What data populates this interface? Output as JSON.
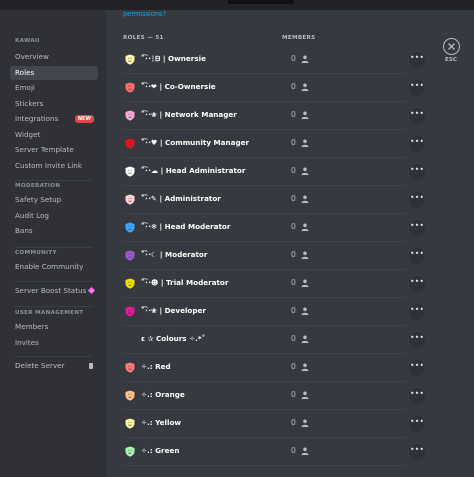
{
  "sidebar": {
    "server_name": "KAWAII",
    "items_top": [
      {
        "label": "Overview",
        "name": "sidebar-item-overview",
        "selected": false
      },
      {
        "label": "Roles",
        "name": "sidebar-item-roles",
        "selected": true
      },
      {
        "label": "Emoji",
        "name": "sidebar-item-emoji",
        "selected": false
      },
      {
        "label": "Stickers",
        "name": "sidebar-item-stickers",
        "selected": false
      },
      {
        "label": "Integrations",
        "name": "sidebar-item-integrations",
        "selected": false,
        "badge": "NEW"
      },
      {
        "label": "Widget",
        "name": "sidebar-item-widget",
        "selected": false
      },
      {
        "label": "Server Template",
        "name": "sidebar-item-server-template",
        "selected": false
      },
      {
        "label": "Custom Invite Link",
        "name": "sidebar-item-custom-invite-link",
        "selected": false
      }
    ],
    "moderation_title": "MODERATION",
    "moderation_items": [
      {
        "label": "Safety Setup",
        "name": "sidebar-item-safety-setup"
      },
      {
        "label": "Audit Log",
        "name": "sidebar-item-audit-log"
      },
      {
        "label": "Bans",
        "name": "sidebar-item-bans"
      }
    ],
    "community_title": "COMMUNITY",
    "community_items": [
      {
        "label": "Enable Community",
        "name": "sidebar-item-enable-community"
      }
    ],
    "boost_label": "Server Boost Status",
    "user_mgmt_title": "USER MANAGEMENT",
    "user_mgmt_items": [
      {
        "label": "Members",
        "name": "sidebar-item-members"
      },
      {
        "label": "Invites",
        "name": "sidebar-item-invites"
      }
    ],
    "delete_label": "Delete Server"
  },
  "main": {
    "permissions_link": "permissions?",
    "roles_header": "ROLES — 51",
    "members_header": "MEMBERS",
    "esc_label": "ESC",
    "roles": [
      {
        "name": "˚͡˔·ᛁᗹ | Ownersie",
        "color": "#fff3b0",
        "members": "0"
      },
      {
        "name": "˚͡˔·❤ | Co-Ownersie",
        "color": "#ff6b6b",
        "members": "0"
      },
      {
        "name": "˚͡˔·❀ | Network Manager",
        "color": "#f7a8d8",
        "members": "0"
      },
      {
        "name": "˚͡˔·♥ | Community Manager",
        "color": "#e81123",
        "members": "0"
      },
      {
        "name": "˚͡˔·☁ | Head Administrator",
        "color": "#ffffff",
        "members": "0"
      },
      {
        "name": "˚͡˔·✎ | Administrator",
        "color": "#ffd1d1",
        "members": "0"
      },
      {
        "name": "˚͡˔·❄ | Head Moderator",
        "color": "#3ba6ff",
        "members": "0"
      },
      {
        "name": "˚͡˔·☾ | Moderator",
        "color": "#9b59d6",
        "members": "0"
      },
      {
        "name": "˚͡˔·☻ | Trial Moderator",
        "color": "#f1e000",
        "members": "0"
      },
      {
        "name": "˚͡˔·❀ | Developer",
        "color": "#e81899",
        "members": "0"
      },
      {
        "name": "ε ✰ Colours ✧.*˚",
        "color": "#36393f",
        "members": "0"
      },
      {
        "name": "✧.: Red",
        "color": "#ff7a7a",
        "members": "0"
      },
      {
        "name": "✧.: Orange",
        "color": "#ffc38a",
        "members": "0"
      },
      {
        "name": "✧.: Yellow",
        "color": "#fff3a0",
        "members": "0"
      },
      {
        "name": "✧.: Green",
        "color": "#a6f5b0",
        "members": "0"
      }
    ]
  },
  "icons": {
    "role_icon": "shield-icon",
    "member_icon": "person-icon",
    "more_icon": "more-icon",
    "close_icon": "close-icon",
    "boost_icon": "boost-gem-icon",
    "delete_icon": "trash-icon"
  },
  "colors": {
    "sidebar_bg": "#2f3136",
    "content_bg": "#36393f",
    "new_badge": "#ed4245",
    "link": "#00aff4"
  }
}
